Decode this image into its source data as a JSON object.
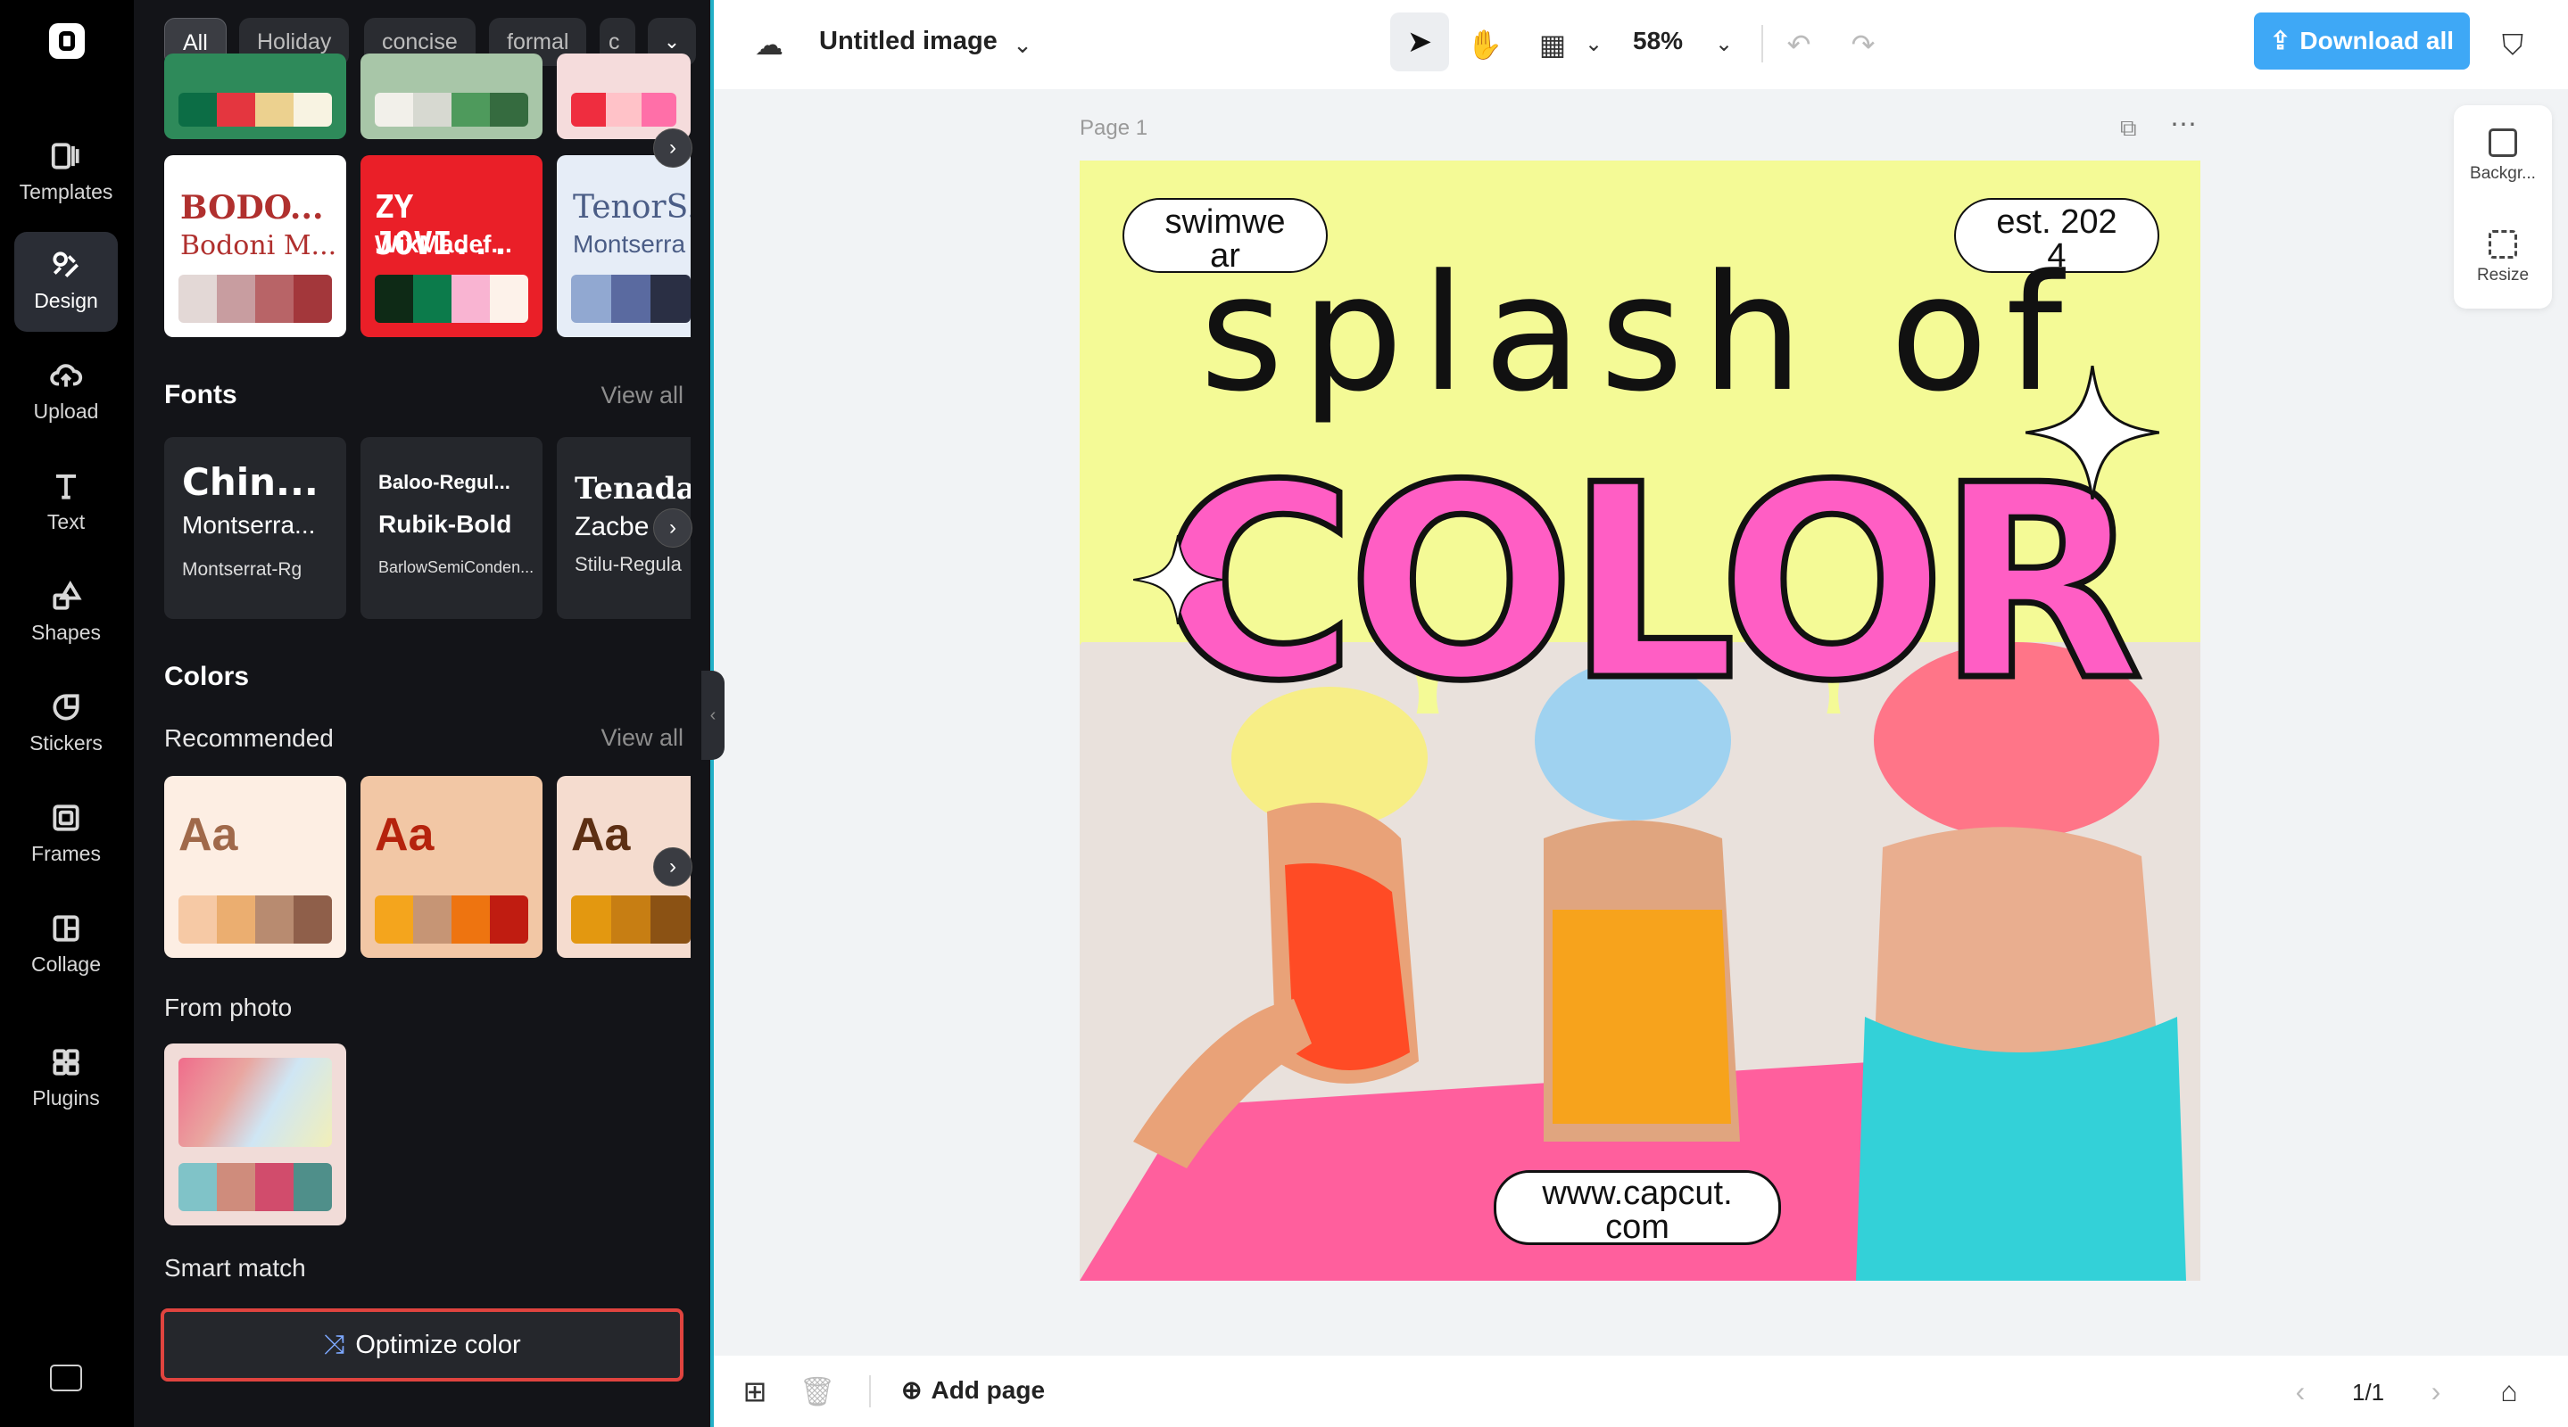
{
  "rail": {
    "items": [
      {
        "label": "Templates",
        "icon": "templates-icon"
      },
      {
        "label": "Design",
        "icon": "design-icon"
      },
      {
        "label": "Upload",
        "icon": "upload-icon"
      },
      {
        "label": "Text",
        "icon": "text-icon"
      },
      {
        "label": "Shapes",
        "icon": "shapes-icon"
      },
      {
        "label": "Stickers",
        "icon": "stickers-icon"
      },
      {
        "label": "Frames",
        "icon": "frames-icon"
      },
      {
        "label": "Collage",
        "icon": "collage-icon"
      },
      {
        "label": "Plugins",
        "icon": "plugins-icon"
      }
    ]
  },
  "panel": {
    "chips": [
      "All",
      "Holiday",
      "concise",
      "formal",
      "c"
    ],
    "theme_cards": [
      {
        "line1": "BODO...",
        "line2": "Bodoni M...",
        "bg": "#ffffff",
        "fg": "#b0302e",
        "swatches": [
          "#e3d8d6",
          "#c89da0",
          "#b86467",
          "#a3373b"
        ]
      },
      {
        "line1": "ZY JOVI...",
        "line2": "WixMadef...",
        "bg": "#ea1f28",
        "fg": "#ffffff",
        "swatches": [
          "#0e2a16",
          "#0c7b4b",
          "#f9b4d2",
          "#fdf2ea"
        ]
      },
      {
        "line1": "TenorS...",
        "line2": "Montserra",
        "bg": "#e6edf7",
        "fg": "#4b5d86",
        "swatches": [
          "#91a8d1",
          "#5a6aa0",
          "#2a2f44"
        ]
      }
    ],
    "fonts_title": "Fonts",
    "fonts_view_all": "View all",
    "font_cards": [
      {
        "l1": "Chin...",
        "l2": "Montserra...",
        "l3": "Montserrat-Rg"
      },
      {
        "l1": "Baloo-Regul...",
        "l2": "Rubik-Bold",
        "l3": "BarlowSemiConden..."
      },
      {
        "l1": "Tenada",
        "l2": "Zacbe",
        "l3": "Stilu-Regula"
      }
    ],
    "colors_title": "Colors",
    "recommended_label": "Recommended",
    "recommended_view_all": "View all",
    "color_cards": [
      {
        "aa": "Aa",
        "bg": "#fdeee3",
        "fg": "#a0694a",
        "swatches": [
          "#f6c9a5",
          "#ebae70",
          "#b88b70",
          "#8f5f4a"
        ]
      },
      {
        "aa": "Aa",
        "bg": "#f2c7a5",
        "fg": "#b5230d",
        "swatches": [
          "#f4a51d",
          "#c69575",
          "#ee7410",
          "#c01c11"
        ]
      },
      {
        "aa": "Aa",
        "bg": "#f5dccf",
        "fg": "#5d2f13",
        "swatches": [
          "#e39810",
          "#c77e13",
          "#8b5214"
        ]
      }
    ],
    "from_photo_label": "From photo",
    "photo_swatches": [
      "#80c3c8",
      "#cf8c7c",
      "#d14c6c",
      "#4f8f8a"
    ],
    "smart_match_label": "Smart match",
    "optimize_label": "Optimize color"
  },
  "topbar": {
    "title": "Untitled image",
    "zoom": "58%",
    "download_label": "Download all"
  },
  "canvas": {
    "page_label": "Page 1",
    "pill_left": "swimwe\nar",
    "pill_right": "est. 202\n4",
    "headline": "splash of",
    "big_word": "COLOR",
    "url": "www.capcut.\ncom",
    "bg_color": "#f4fa96",
    "accent_pink": "#ff5ec4"
  },
  "mini_panel": {
    "background_label": "Backgr...",
    "resize_label": "Resize"
  },
  "bottombar": {
    "add_page_label": "Add page",
    "page_count": "1/1"
  }
}
